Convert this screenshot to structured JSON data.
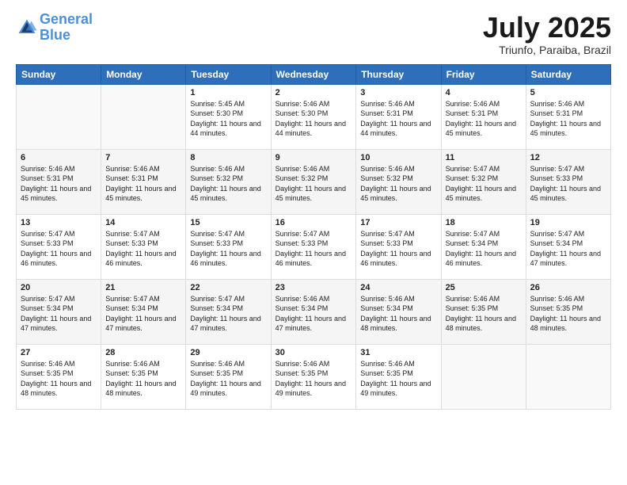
{
  "header": {
    "logo_line1": "General",
    "logo_line2": "Blue",
    "month": "July 2025",
    "location": "Triunfo, Paraiba, Brazil"
  },
  "days_of_week": [
    "Sunday",
    "Monday",
    "Tuesday",
    "Wednesday",
    "Thursday",
    "Friday",
    "Saturday"
  ],
  "weeks": [
    [
      {
        "day": "",
        "content": ""
      },
      {
        "day": "",
        "content": ""
      },
      {
        "day": "1",
        "content": "Sunrise: 5:45 AM\nSunset: 5:30 PM\nDaylight: 11 hours and 44 minutes."
      },
      {
        "day": "2",
        "content": "Sunrise: 5:46 AM\nSunset: 5:30 PM\nDaylight: 11 hours and 44 minutes."
      },
      {
        "day": "3",
        "content": "Sunrise: 5:46 AM\nSunset: 5:31 PM\nDaylight: 11 hours and 44 minutes."
      },
      {
        "day": "4",
        "content": "Sunrise: 5:46 AM\nSunset: 5:31 PM\nDaylight: 11 hours and 45 minutes."
      },
      {
        "day": "5",
        "content": "Sunrise: 5:46 AM\nSunset: 5:31 PM\nDaylight: 11 hours and 45 minutes."
      }
    ],
    [
      {
        "day": "6",
        "content": "Sunrise: 5:46 AM\nSunset: 5:31 PM\nDaylight: 11 hours and 45 minutes."
      },
      {
        "day": "7",
        "content": "Sunrise: 5:46 AM\nSunset: 5:31 PM\nDaylight: 11 hours and 45 minutes."
      },
      {
        "day": "8",
        "content": "Sunrise: 5:46 AM\nSunset: 5:32 PM\nDaylight: 11 hours and 45 minutes."
      },
      {
        "day": "9",
        "content": "Sunrise: 5:46 AM\nSunset: 5:32 PM\nDaylight: 11 hours and 45 minutes."
      },
      {
        "day": "10",
        "content": "Sunrise: 5:46 AM\nSunset: 5:32 PM\nDaylight: 11 hours and 45 minutes."
      },
      {
        "day": "11",
        "content": "Sunrise: 5:47 AM\nSunset: 5:32 PM\nDaylight: 11 hours and 45 minutes."
      },
      {
        "day": "12",
        "content": "Sunrise: 5:47 AM\nSunset: 5:33 PM\nDaylight: 11 hours and 45 minutes."
      }
    ],
    [
      {
        "day": "13",
        "content": "Sunrise: 5:47 AM\nSunset: 5:33 PM\nDaylight: 11 hours and 46 minutes."
      },
      {
        "day": "14",
        "content": "Sunrise: 5:47 AM\nSunset: 5:33 PM\nDaylight: 11 hours and 46 minutes."
      },
      {
        "day": "15",
        "content": "Sunrise: 5:47 AM\nSunset: 5:33 PM\nDaylight: 11 hours and 46 minutes."
      },
      {
        "day": "16",
        "content": "Sunrise: 5:47 AM\nSunset: 5:33 PM\nDaylight: 11 hours and 46 minutes."
      },
      {
        "day": "17",
        "content": "Sunrise: 5:47 AM\nSunset: 5:33 PM\nDaylight: 11 hours and 46 minutes."
      },
      {
        "day": "18",
        "content": "Sunrise: 5:47 AM\nSunset: 5:34 PM\nDaylight: 11 hours and 46 minutes."
      },
      {
        "day": "19",
        "content": "Sunrise: 5:47 AM\nSunset: 5:34 PM\nDaylight: 11 hours and 47 minutes."
      }
    ],
    [
      {
        "day": "20",
        "content": "Sunrise: 5:47 AM\nSunset: 5:34 PM\nDaylight: 11 hours and 47 minutes."
      },
      {
        "day": "21",
        "content": "Sunrise: 5:47 AM\nSunset: 5:34 PM\nDaylight: 11 hours and 47 minutes."
      },
      {
        "day": "22",
        "content": "Sunrise: 5:47 AM\nSunset: 5:34 PM\nDaylight: 11 hours and 47 minutes."
      },
      {
        "day": "23",
        "content": "Sunrise: 5:46 AM\nSunset: 5:34 PM\nDaylight: 11 hours and 47 minutes."
      },
      {
        "day": "24",
        "content": "Sunrise: 5:46 AM\nSunset: 5:34 PM\nDaylight: 11 hours and 48 minutes."
      },
      {
        "day": "25",
        "content": "Sunrise: 5:46 AM\nSunset: 5:35 PM\nDaylight: 11 hours and 48 minutes."
      },
      {
        "day": "26",
        "content": "Sunrise: 5:46 AM\nSunset: 5:35 PM\nDaylight: 11 hours and 48 minutes."
      }
    ],
    [
      {
        "day": "27",
        "content": "Sunrise: 5:46 AM\nSunset: 5:35 PM\nDaylight: 11 hours and 48 minutes."
      },
      {
        "day": "28",
        "content": "Sunrise: 5:46 AM\nSunset: 5:35 PM\nDaylight: 11 hours and 48 minutes."
      },
      {
        "day": "29",
        "content": "Sunrise: 5:46 AM\nSunset: 5:35 PM\nDaylight: 11 hours and 49 minutes."
      },
      {
        "day": "30",
        "content": "Sunrise: 5:46 AM\nSunset: 5:35 PM\nDaylight: 11 hours and 49 minutes."
      },
      {
        "day": "31",
        "content": "Sunrise: 5:46 AM\nSunset: 5:35 PM\nDaylight: 11 hours and 49 minutes."
      },
      {
        "day": "",
        "content": ""
      },
      {
        "day": "",
        "content": ""
      }
    ]
  ]
}
